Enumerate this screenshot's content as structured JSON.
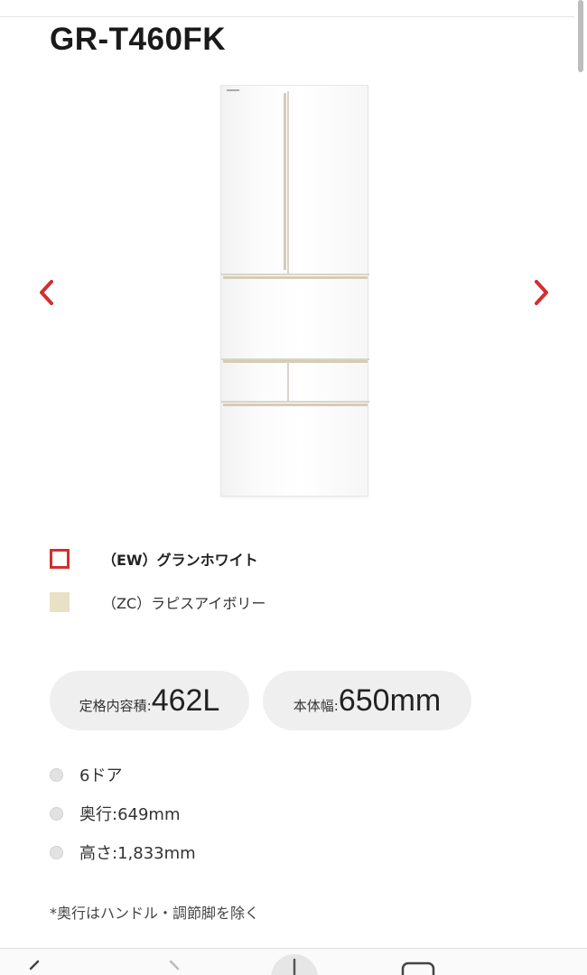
{
  "product": {
    "model": "GR-T460FK"
  },
  "carousel": {
    "prev_icon": "chevron-left-icon",
    "next_icon": "chevron-right-icon",
    "arrow_color": "#d32f2f"
  },
  "colors": [
    {
      "code_label": "（EW）グランホワイト",
      "swatch": "#ffffff",
      "border": "#d32f2f",
      "selected": true
    },
    {
      "code_label": "（ZC）ラピスアイボリー",
      "swatch": "#e8e1c6",
      "selected": false
    }
  ],
  "highlights": {
    "capacity": {
      "label": "定格内容積:",
      "value": "462L"
    },
    "width": {
      "label": "本体幅:",
      "value": "650mm"
    }
  },
  "specs": [
    {
      "text": "6ドア"
    },
    {
      "text": "奥行:649mm"
    },
    {
      "text": "高さ:1,833mm"
    }
  ],
  "note": "*奥行はハンドル・調節脚を除く",
  "browser_bar": {
    "icons": [
      "back-icon",
      "forward-icon",
      "add-tab-icon",
      "tabs-icon"
    ]
  }
}
